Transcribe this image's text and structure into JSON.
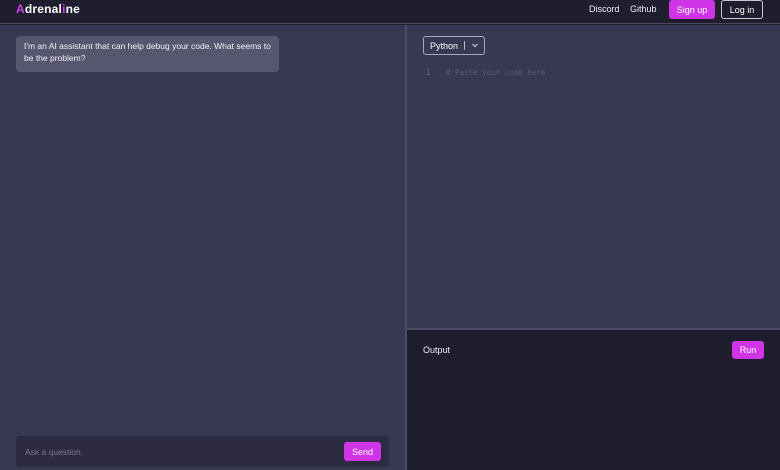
{
  "header": {
    "logo_first": "A",
    "logo_rest": "drenal",
    "logo_i": "i",
    "logo_end": "ne",
    "nav": {
      "discord": "Discord",
      "github": "Github",
      "signup": "Sign up",
      "login": "Log in"
    }
  },
  "chat": {
    "assistant_message": "I'm an AI assistant that can help debug your code. What seems to be the problem?",
    "input_placeholder": "Ask a question",
    "send_label": "Send"
  },
  "editor": {
    "language": "Python",
    "line_number": "1",
    "placeholder_comment": "# Paste your code here"
  },
  "output": {
    "label": "Output",
    "run_label": "Run"
  },
  "colors": {
    "accent": "#cf35e6",
    "panel": "#393853",
    "background": "#1f1e2e"
  },
  "icons": {
    "language_dropdown": "chevron-down-icon"
  }
}
